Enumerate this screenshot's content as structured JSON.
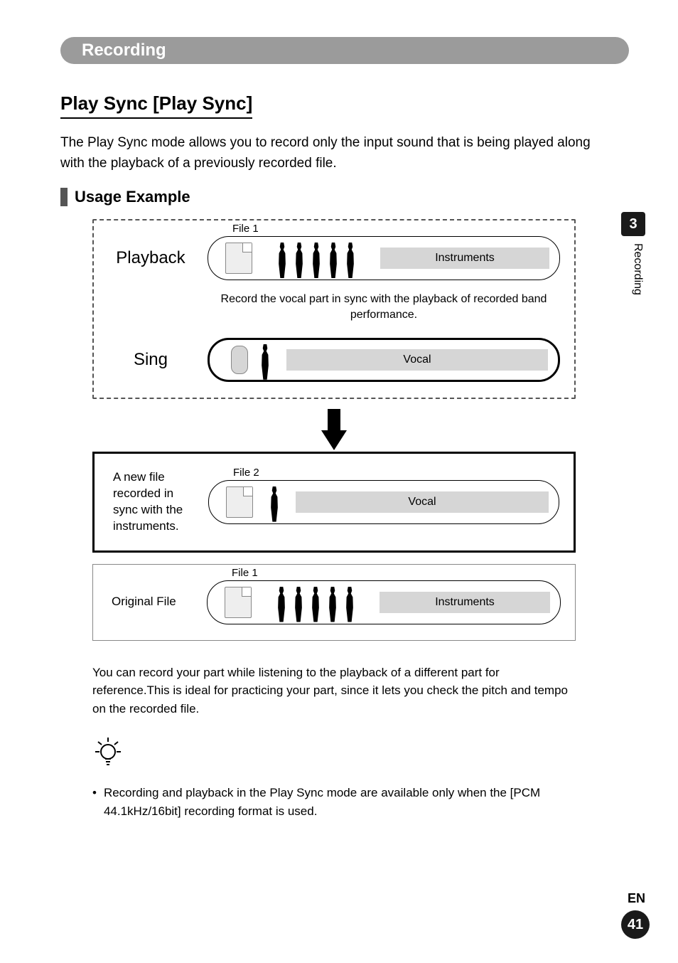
{
  "chapter": {
    "title": "Recording"
  },
  "section": {
    "title": "Play Sync [Play Sync]"
  },
  "intro": "The Play Sync mode allows you to record only the input sound that is being played along with the playback of a previously recorded file.",
  "usage": {
    "heading": "Usage Example"
  },
  "diagram": {
    "playback": {
      "label": "Playback",
      "file": "File 1",
      "tag": "Instruments"
    },
    "caption": "Record the vocal part in sync with the playback of recorded band performance.",
    "sing": {
      "label": "Sing",
      "tag": "Vocal"
    },
    "result": {
      "label": "A new file recorded in sync with the instruments.",
      "file": "File 2",
      "tag": "Vocal"
    },
    "original": {
      "label": "Original File",
      "file": "File 1",
      "tag": "Instruments"
    }
  },
  "after_text": "You can record your part while listening to the playback of a different part for reference.This is ideal for practicing your part, since it lets you check the pitch and tempo on the recorded file.",
  "note": {
    "pre": "Recording and playback in the Play Sync mode are available only when the [",
    "bold": "PCM 44.1kHz/16bit",
    "post": "] recording format is used."
  },
  "side": {
    "chapter_num": "3",
    "chapter_label": "Recording"
  },
  "footer": {
    "lang": "EN",
    "page": "41"
  }
}
